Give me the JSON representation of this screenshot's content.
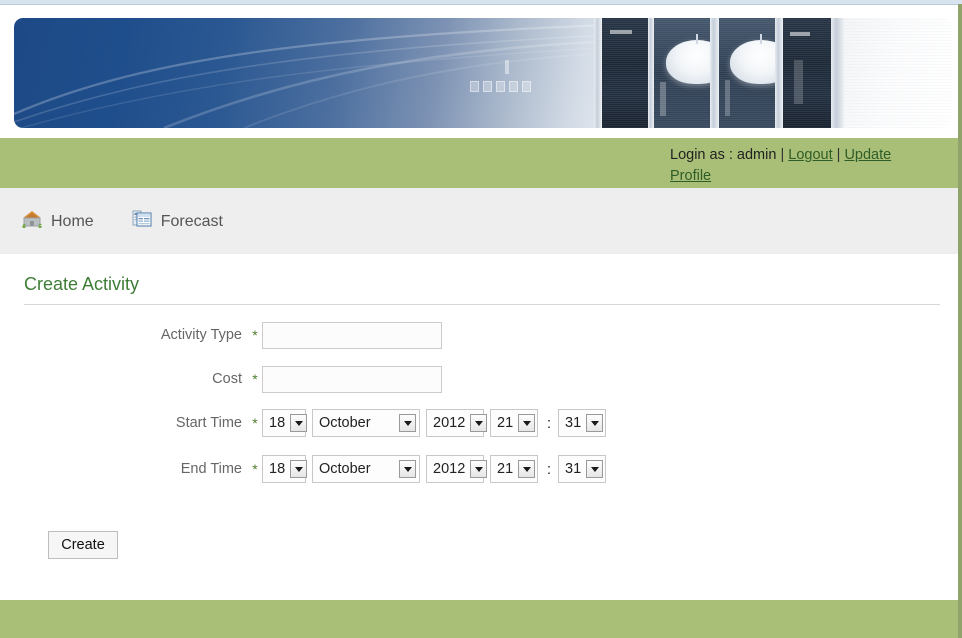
{
  "theme": {
    "green_bar": "#a9bf77",
    "heading_green": "#3e7d36",
    "link_green": "#2f5d28",
    "nav_gray": "#eeeeee",
    "label_gray": "#666666",
    "banner_blue": "#1d4a86"
  },
  "banner": {
    "alt": "office-lobby-banner-image"
  },
  "loginbar": {
    "prefix": "Login as : ",
    "username": "admin",
    "separator": " | ",
    "logout_label": "Logout",
    "update_profile_label": "Update Profile"
  },
  "nav": {
    "items": [
      {
        "label": "Home",
        "icon": "home-icon"
      },
      {
        "label": "Forecast",
        "icon": "report-icon"
      }
    ]
  },
  "page": {
    "title": "Create Activity"
  },
  "form": {
    "required_marker": "*",
    "time_separator": ":",
    "fields": [
      {
        "label": "Activity Type",
        "value": "",
        "placeholder": ""
      },
      {
        "label": "Cost",
        "value": "",
        "placeholder": ""
      }
    ],
    "datetime_rows": [
      {
        "label": "Start Time",
        "day": "18",
        "month": "October",
        "year": "2012",
        "hour": "21",
        "minute": "31"
      },
      {
        "label": "End Time",
        "day": "18",
        "month": "October",
        "year": "2012",
        "hour": "21",
        "minute": "31"
      }
    ],
    "submit_label": "Create"
  }
}
